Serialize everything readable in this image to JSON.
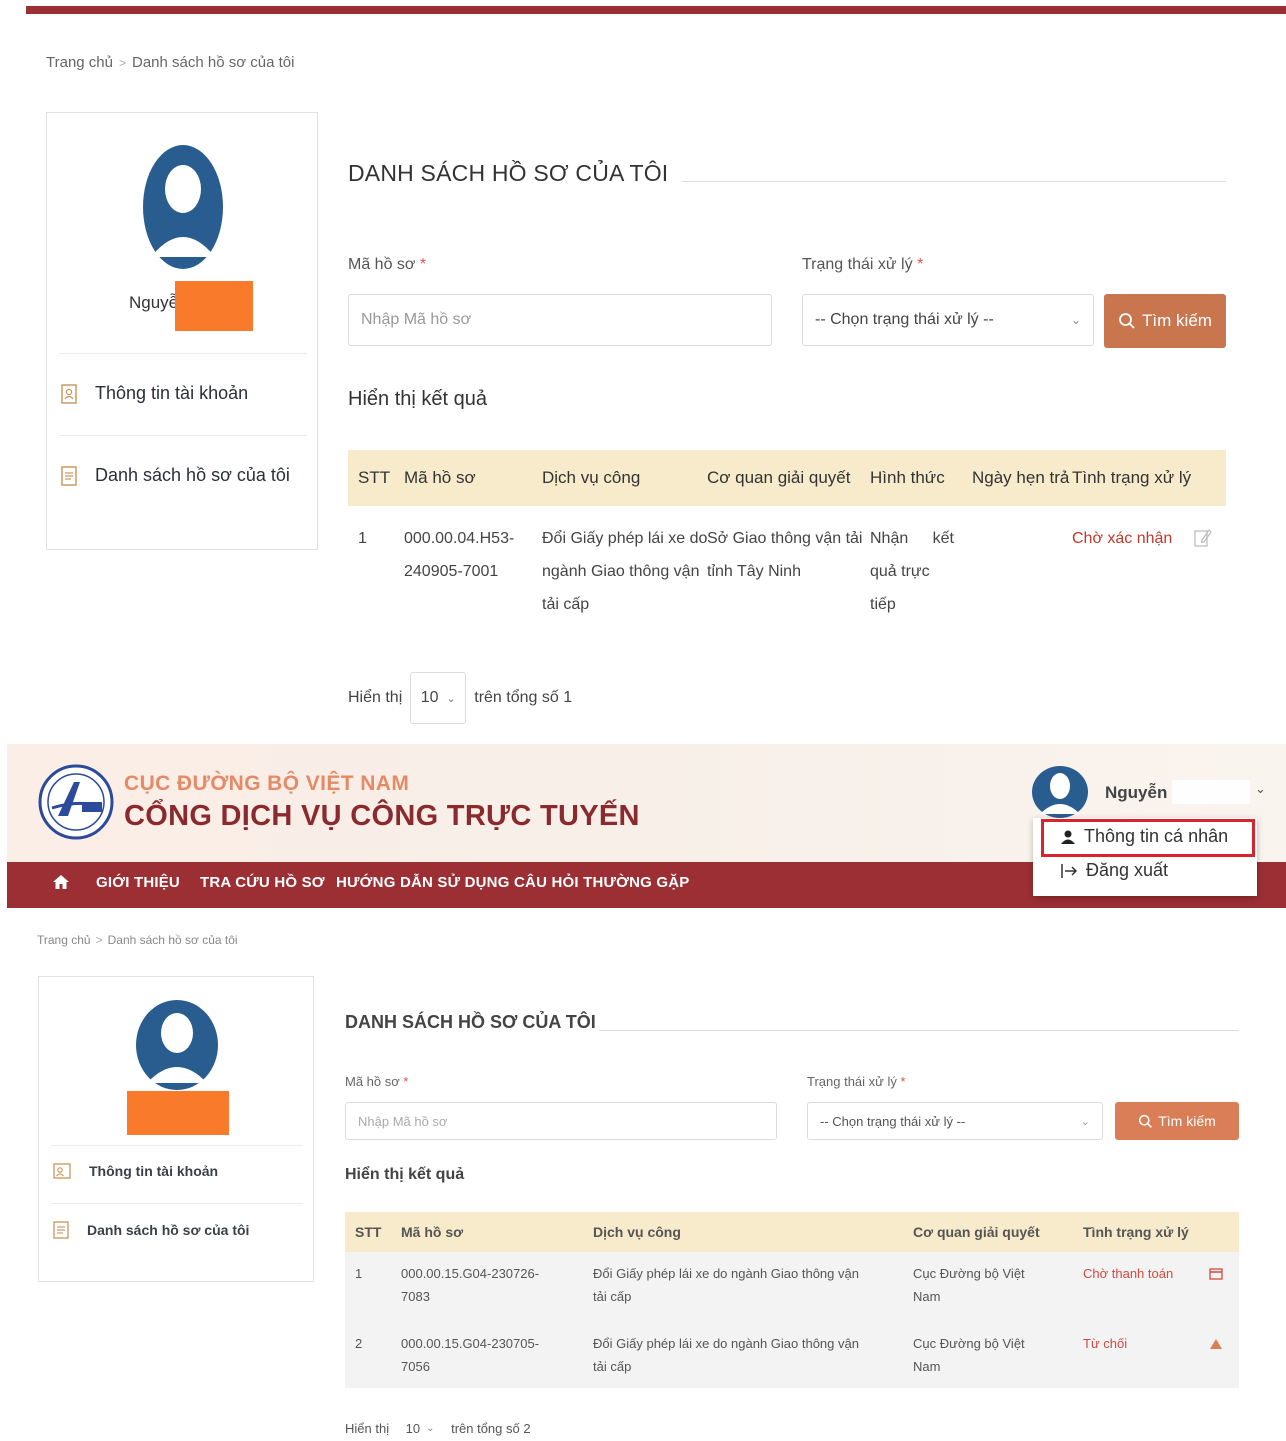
{
  "panel1": {
    "breadcrumb": {
      "home": "Trang chủ",
      "current": "Danh sách hồ sơ của tôi"
    },
    "sidebar": {
      "username": "Nguyễn",
      "items": [
        {
          "label": "Thông tin tài khoản",
          "icon": "user-card-icon"
        },
        {
          "label": "Danh sách hồ sơ của tôi",
          "icon": "document-icon"
        }
      ]
    },
    "main": {
      "title": "DANH SÁCH HỒ SƠ CỦA TÔI",
      "form": {
        "code_label": "Mã hồ sơ",
        "code_placeholder": "Nhập Mã hồ sơ",
        "status_label": "Trạng thái xử lý",
        "status_value": "-- Chọn trạng thái xử lý --",
        "required_mark": "*",
        "search_button": "Tìm kiếm"
      },
      "result_heading": "Hiển thị kết quả",
      "table": {
        "headers": [
          "STT",
          "Mã hồ sơ",
          "Dịch vụ công",
          "Cơ quan giải quyết",
          "Hình thức",
          "Ngày hẹn trả",
          "Tình trạng xử lý"
        ],
        "rows": [
          {
            "stt": "1",
            "code_l1": "000.00.04.H53-",
            "code_l2": "240905-7001",
            "service_l1": "Đổi Giấy phép lái xe do",
            "service_l2": "ngành Giao thông vận",
            "service_l3": "tải cấp",
            "agency_l1": "Sở Giao thông vận tải",
            "agency_l2": "tỉnh Tây Ninh",
            "form_l1a": "Nhận",
            "form_l1b": "kết",
            "form_l2": "quả trực tiếp",
            "due": "",
            "status": "Chờ xác nhận"
          }
        ]
      },
      "pager": {
        "show": "Hiển thị",
        "page_size": "10",
        "total_text": "trên tổng số 1"
      }
    }
  },
  "panel2": {
    "header": {
      "org": "CỤC ĐƯỜNG BỘ VIỆT NAM",
      "portal": "CỔNG DỊCH VỤ CÔNG TRỰC TUYẾN",
      "username": "Nguyễn"
    },
    "nav": [
      "GIỚI THIỆU",
      "TRA CỨU HỒ SƠ",
      "HƯỚNG DẪN SỬ DỤNG",
      "CÂU HỎI THƯỜNG GẶP"
    ],
    "user_menu": [
      {
        "label": "Thông tin cá nhân",
        "icon": "user-icon"
      },
      {
        "label": "Đăng xuất",
        "icon": "logout-icon"
      }
    ],
    "breadcrumb": {
      "home": "Trang chủ",
      "current": "Danh sách hồ sơ của tôi"
    },
    "sidebar": {
      "items": [
        {
          "label": "Thông tin tài khoản",
          "icon": "user-card-icon"
        },
        {
          "label": "Danh sách hồ sơ của tôi",
          "icon": "document-icon"
        }
      ]
    },
    "main": {
      "title": "DANH SÁCH HỒ SƠ CỦA TÔI",
      "form": {
        "code_label": "Mã hồ sơ",
        "code_placeholder": "Nhập Mã hồ sơ",
        "status_label": "Trạng thái xử lý",
        "status_value": "-- Chọn trạng thái xử lý --",
        "required_mark": "*",
        "search_button": "Tìm kiếm"
      },
      "result_heading": "Hiển thị kết quả",
      "table": {
        "headers": [
          "STT",
          "Mã hồ sơ",
          "Dịch vụ công",
          "Cơ quan giải quyết",
          "Tình trạng xử lý"
        ],
        "rows": [
          {
            "stt": "1",
            "code_l1": "000.00.15.G04-230726-",
            "code_l2": "7083",
            "service_l1": "Đổi Giấy phép lái xe do ngành Giao thông vận",
            "service_l2": "tải cấp",
            "agency_l1": "Cục Đường bộ Việt",
            "agency_l2": "Nam",
            "status": "Chờ thanh toán"
          },
          {
            "stt": "2",
            "code_l1": "000.00.15.G04-230705-",
            "code_l2": "7056",
            "service_l1": "Đổi Giấy phép lái xe do ngành Giao thông vận",
            "service_l2": "tải cấp",
            "agency_l1": "Cục Đường bộ Việt",
            "agency_l2": "Nam",
            "status": "Từ chối"
          }
        ]
      },
      "pager": {
        "show": "Hiển thị",
        "page_size": "10",
        "total_text": "trên tổng số 2"
      }
    }
  },
  "colors": {
    "brand": "#9b2f34",
    "accent_button": "#c9764f",
    "table_header": "#f7ebcb",
    "status_red": "#c0392b",
    "redaction": "#f97a2a",
    "highlight_box": "#d9232d"
  }
}
